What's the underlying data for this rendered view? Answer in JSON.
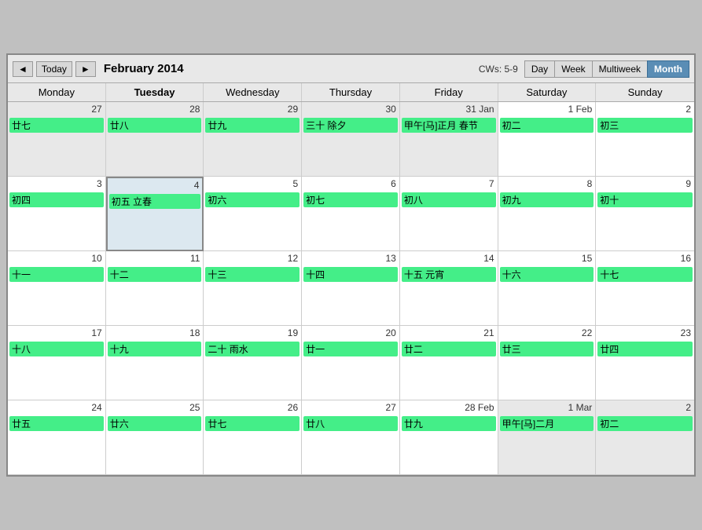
{
  "header": {
    "prev_label": "◄",
    "today_label": "Today",
    "next_label": "►",
    "title": "February 2014",
    "cw_info": "CWs: 5-9",
    "views": [
      {
        "key": "day",
        "label": "Day",
        "active": false
      },
      {
        "key": "week",
        "label": "Week",
        "active": false
      },
      {
        "key": "multiweek",
        "label": "Multiweek",
        "active": false
      },
      {
        "key": "month",
        "label": "Month",
        "active": true
      }
    ]
  },
  "weekdays": [
    "Monday",
    "Tuesday",
    "Wednesday",
    "Thursday",
    "Friday",
    "Saturday",
    "Sunday"
  ],
  "weeks": [
    {
      "days": [
        {
          "date": "27",
          "lunar": "廿七",
          "other": true
        },
        {
          "date": "28",
          "lunar": "廿八",
          "other": true
        },
        {
          "date": "29",
          "lunar": "廿九",
          "other": true
        },
        {
          "date": "30",
          "lunar": "三十 除夕",
          "other": true
        },
        {
          "date": "31",
          "lunar": "甲午[马]正月 春节",
          "other": true,
          "month_label": "jan"
        },
        {
          "date": "1",
          "lunar": "初二",
          "other": false,
          "month_label": "feb"
        },
        {
          "date": "2",
          "lunar": "初三",
          "other": false
        }
      ]
    },
    {
      "days": [
        {
          "date": "3",
          "lunar": "初四",
          "other": false
        },
        {
          "date": "4",
          "lunar": "初五 立春",
          "other": false,
          "today": true
        },
        {
          "date": "5",
          "lunar": "初六",
          "other": false
        },
        {
          "date": "6",
          "lunar": "初七",
          "other": false
        },
        {
          "date": "7",
          "lunar": "初八",
          "other": false
        },
        {
          "date": "8",
          "lunar": "初九",
          "other": false
        },
        {
          "date": "9",
          "lunar": "初十",
          "other": false
        }
      ]
    },
    {
      "days": [
        {
          "date": "10",
          "lunar": "十一",
          "other": false
        },
        {
          "date": "11",
          "lunar": "十二",
          "other": false
        },
        {
          "date": "12",
          "lunar": "十三",
          "other": false
        },
        {
          "date": "13",
          "lunar": "十四",
          "other": false
        },
        {
          "date": "14",
          "lunar": "十五 元宵",
          "other": false
        },
        {
          "date": "15",
          "lunar": "十六",
          "other": false
        },
        {
          "date": "16",
          "lunar": "十七",
          "other": false
        }
      ]
    },
    {
      "days": [
        {
          "date": "17",
          "lunar": "十八",
          "other": false
        },
        {
          "date": "18",
          "lunar": "十九",
          "other": false
        },
        {
          "date": "19",
          "lunar": "二十 雨水",
          "other": false
        },
        {
          "date": "20",
          "lunar": "廿一",
          "other": false
        },
        {
          "date": "21",
          "lunar": "廿二",
          "other": false
        },
        {
          "date": "22",
          "lunar": "廿三",
          "other": false
        },
        {
          "date": "23",
          "lunar": "廿四",
          "other": false
        }
      ]
    },
    {
      "days": [
        {
          "date": "24",
          "lunar": "廿五",
          "other": false
        },
        {
          "date": "25",
          "lunar": "廿六",
          "other": false
        },
        {
          "date": "26",
          "lunar": "廿七",
          "other": false
        },
        {
          "date": "27",
          "lunar": "廿八",
          "other": false
        },
        {
          "date": "28",
          "lunar": "廿九",
          "other": false,
          "month_label": "feb"
        },
        {
          "date": "1",
          "lunar": "甲午[马]二月",
          "other": true,
          "month_label": "mar"
        },
        {
          "date": "2",
          "lunar": "初二",
          "other": true
        }
      ]
    }
  ]
}
